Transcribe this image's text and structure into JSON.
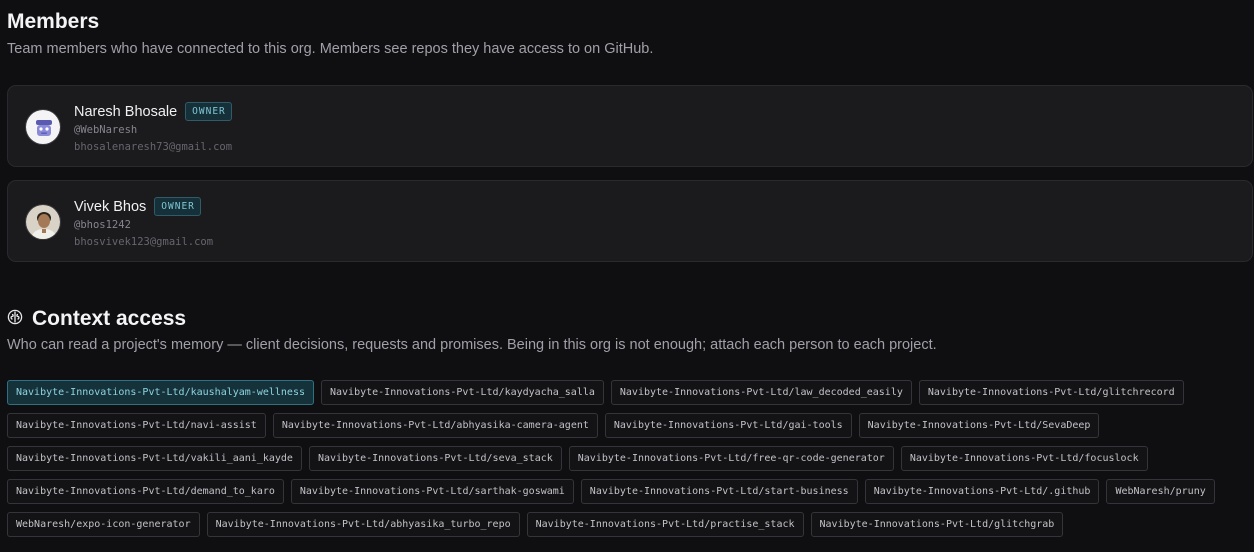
{
  "members_section": {
    "title": "Members",
    "subtitle": "Team members who have connected to this org. Members see repos they have access to on GitHub."
  },
  "members": [
    {
      "name": "Naresh Bhosale",
      "role": "OWNER",
      "handle": "@WebNaresh",
      "email": "bhosalenaresh73@gmail.com"
    },
    {
      "name": "Vivek Bhos",
      "role": "OWNER",
      "handle": "@bhos1242",
      "email": "bhosvivek123@gmail.com"
    }
  ],
  "context_section": {
    "icon": "brain-icon",
    "title": "Context access",
    "subtitle": "Who can read a project's memory — client decisions, requests and promises. Being in this org is not enough; attach each person to each project."
  },
  "projects": [
    {
      "label": "Navibyte-Innovations-Pvt-Ltd/kaushalyam-wellness",
      "selected": true
    },
    {
      "label": "Navibyte-Innovations-Pvt-Ltd/kaydyacha_salla",
      "selected": false
    },
    {
      "label": "Navibyte-Innovations-Pvt-Ltd/law_decoded_easily",
      "selected": false
    },
    {
      "label": "Navibyte-Innovations-Pvt-Ltd/glitchrecord",
      "selected": false
    },
    {
      "label": "Navibyte-Innovations-Pvt-Ltd/navi-assist",
      "selected": false
    },
    {
      "label": "Navibyte-Innovations-Pvt-Ltd/abhyasika-camera-agent",
      "selected": false
    },
    {
      "label": "Navibyte-Innovations-Pvt-Ltd/gai-tools",
      "selected": false
    },
    {
      "label": "Navibyte-Innovations-Pvt-Ltd/SevaDeep",
      "selected": false
    },
    {
      "label": "Navibyte-Innovations-Pvt-Ltd/vakili_aani_kayde",
      "selected": false
    },
    {
      "label": "Navibyte-Innovations-Pvt-Ltd/seva_stack",
      "selected": false
    },
    {
      "label": "Navibyte-Innovations-Pvt-Ltd/free-qr-code-generator",
      "selected": false
    },
    {
      "label": "Navibyte-Innovations-Pvt-Ltd/focuslock",
      "selected": false
    },
    {
      "label": "Navibyte-Innovations-Pvt-Ltd/demand_to_karo",
      "selected": false
    },
    {
      "label": "Navibyte-Innovations-Pvt-Ltd/sarthak-goswami",
      "selected": false
    },
    {
      "label": "Navibyte-Innovations-Pvt-Ltd/start-business",
      "selected": false
    },
    {
      "label": "Navibyte-Innovations-Pvt-Ltd/.github",
      "selected": false
    },
    {
      "label": "WebNaresh/pruny",
      "selected": false
    },
    {
      "label": "WebNaresh/expo-icon-generator",
      "selected": false
    },
    {
      "label": "Navibyte-Innovations-Pvt-Ltd/abhyasika_turbo_repo",
      "selected": false
    },
    {
      "label": "Navibyte-Innovations-Pvt-Ltd/practise_stack",
      "selected": false
    },
    {
      "label": "Navibyte-Innovations-Pvt-Ltd/glitchgrab",
      "selected": false
    }
  ],
  "colors": {
    "background": "#0f0f11",
    "card": "#1b1b1e",
    "accent": "#7ec6d3",
    "selected_tag_bg": "#15323b"
  }
}
